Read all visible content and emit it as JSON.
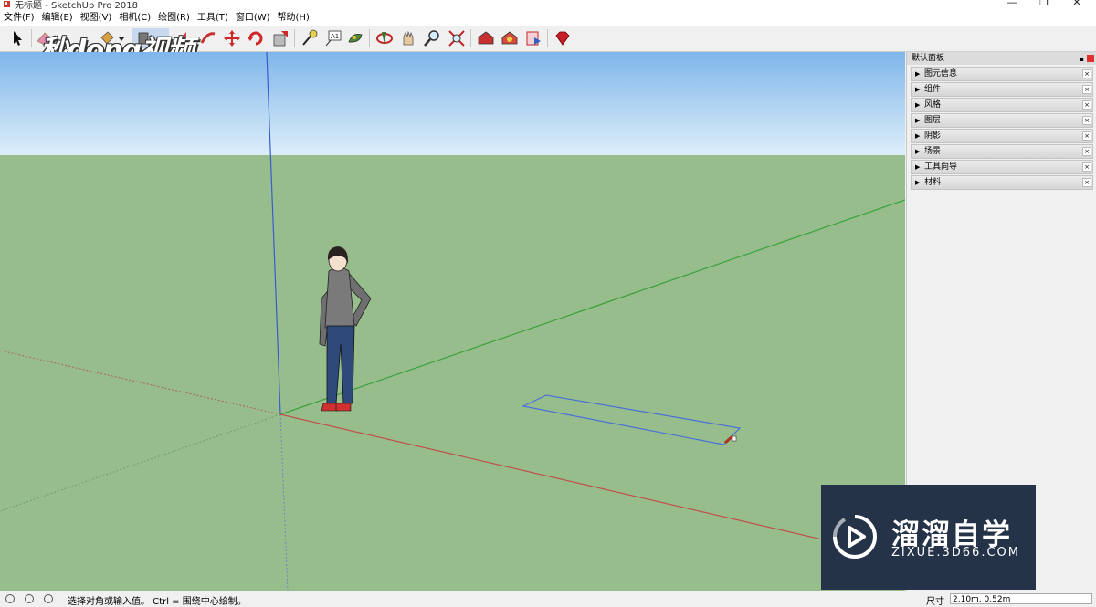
{
  "window": {
    "title": "无标题 - SketchUp Pro 2018",
    "minimize": "—",
    "restore": "❐",
    "close": "✕"
  },
  "menu": [
    "文件(F)",
    "编辑(E)",
    "视图(V)",
    "相机(C)",
    "绘图(R)",
    "工具(T)",
    "窗口(W)",
    "帮助(H)"
  ],
  "toolbar": {
    "icons": [
      "select-icon",
      "eraser-icon",
      "paint-bucket-icon",
      "rectangle-icon",
      "push-pull-icon",
      "follow-me-icon",
      "move-icon",
      "rotate-icon",
      "scale-icon",
      "tape-measure-icon",
      "text-icon",
      "paint-icon",
      "orbit-icon",
      "pan-icon",
      "zoom-icon",
      "zoom-extents-icon",
      "warehouse-icon",
      "extension-warehouse-icon",
      "layout-icon",
      "ruby-icon"
    ]
  },
  "watermark": "秒dong视频",
  "panel": {
    "title": "默认面板",
    "trays": [
      "图元信息",
      "组件",
      "风格",
      "图层",
      "阴影",
      "场景",
      "工具向导",
      "材料"
    ]
  },
  "status": {
    "hint": "选择对角或输入值。 Ctrl = 围绕中心绘制。",
    "measure_label": "尺寸",
    "measure_value": "2.10m, 0.52m"
  },
  "logo": {
    "name": "溜溜自学",
    "url": "ZIXUE.3D66.COM"
  },
  "colors": {
    "sky_top": "#7fb6ea",
    "sky_bottom": "#ddeefa",
    "ground": "#97bd8d",
    "axis_red": "#c0504d",
    "axis_green": "#3aa23a",
    "axis_blue": "#3a5bd0",
    "rectangle": "#4a6fd8"
  }
}
